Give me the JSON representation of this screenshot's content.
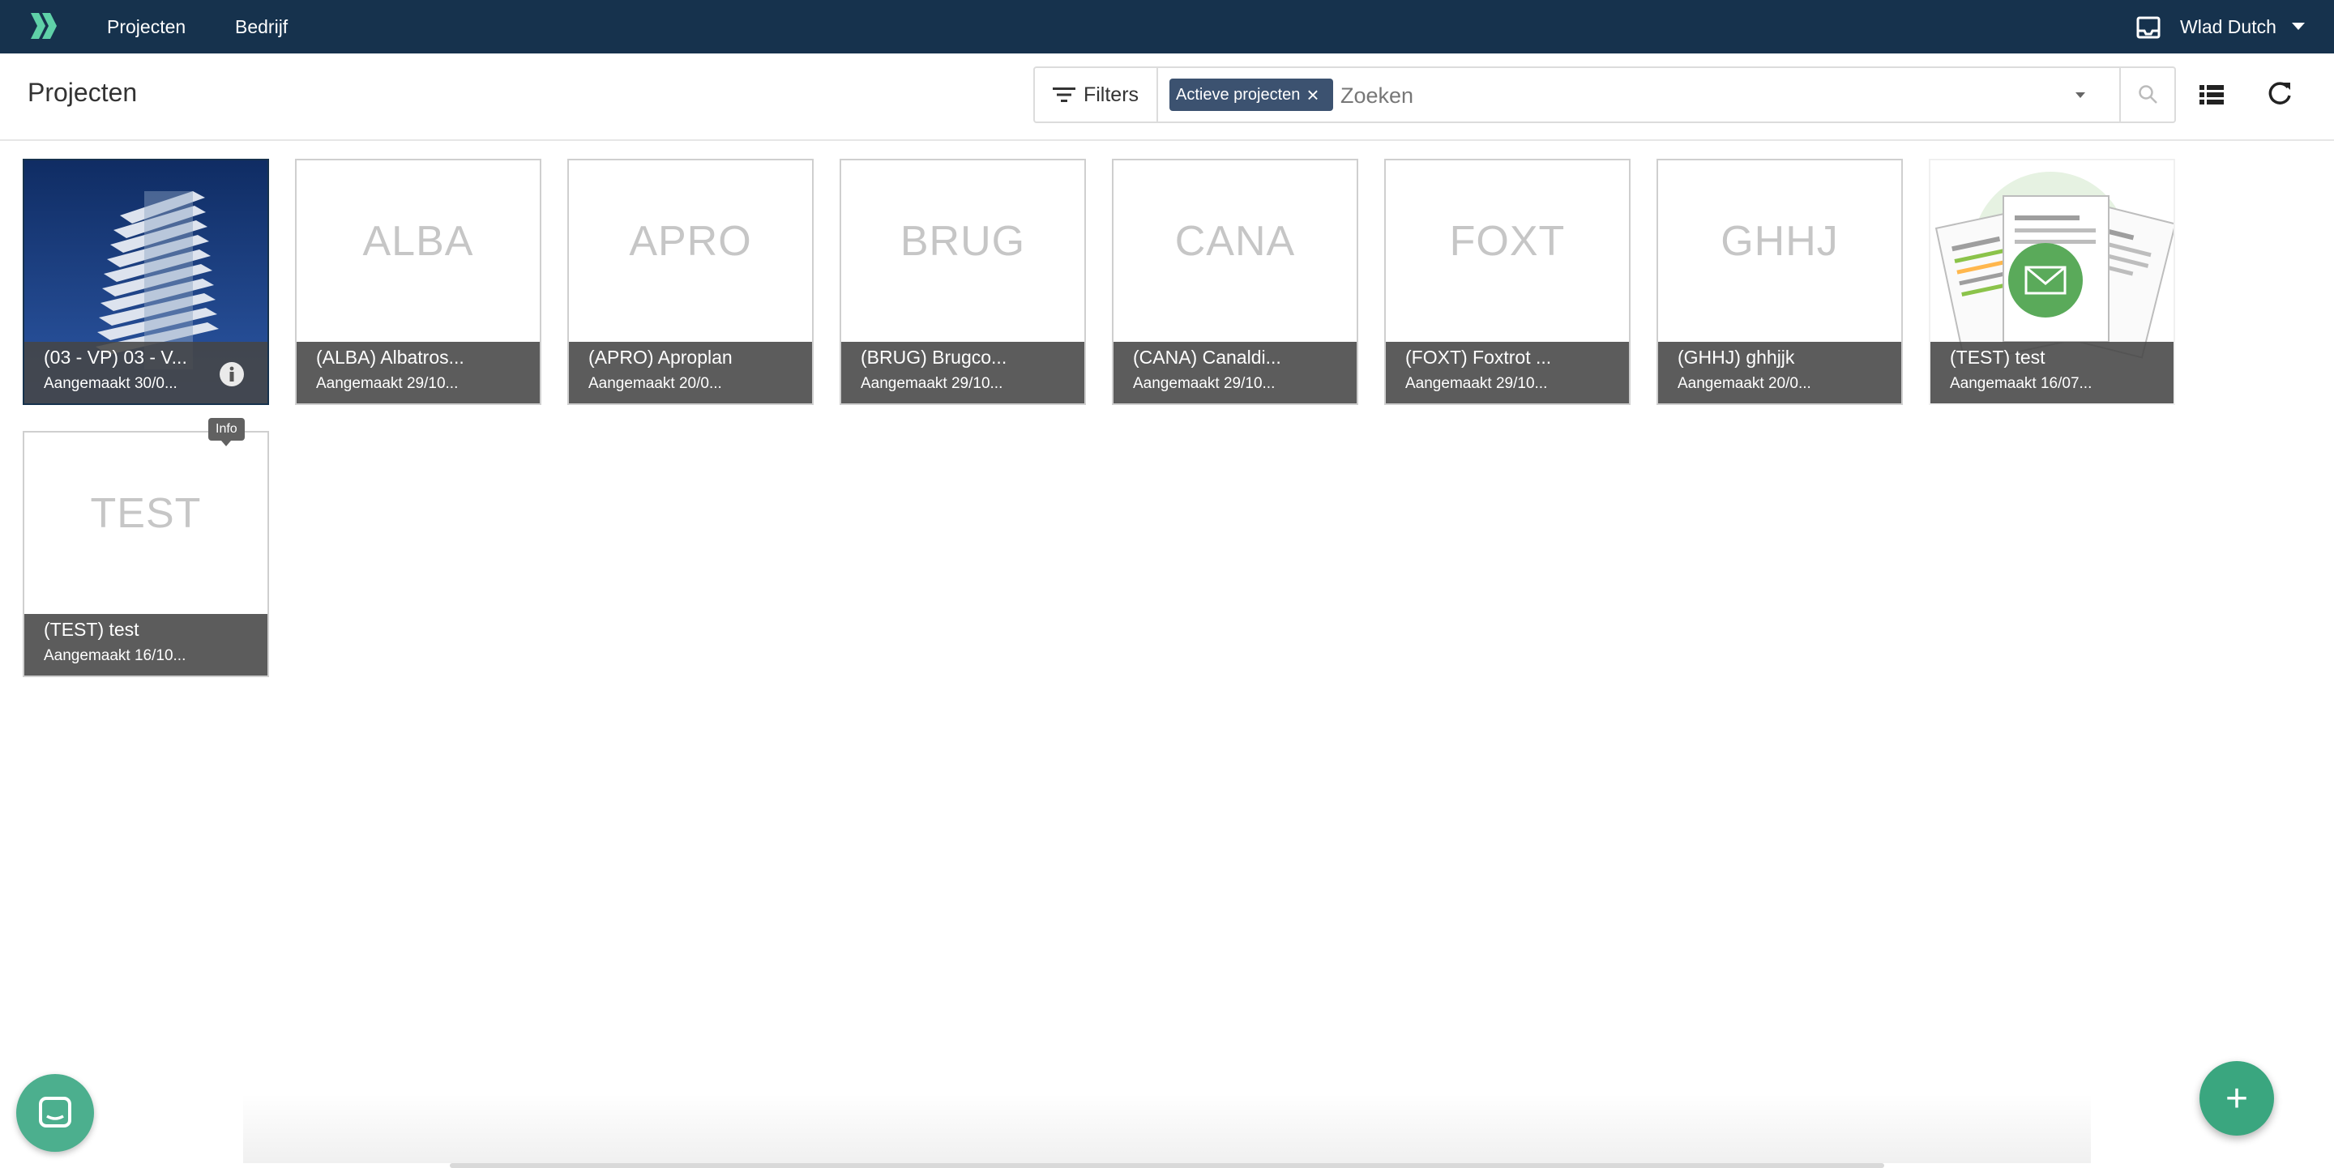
{
  "nav": {
    "items": [
      {
        "label": "Projecten"
      },
      {
        "label": "Bedrijf"
      }
    ],
    "user_name": "Wlad Dutch",
    "logo_icon": "logo-double-chevron-icon",
    "inbox_icon": "inbox-icon"
  },
  "toolbar": {
    "title": "Projecten",
    "filters_label": "Filters",
    "active_chip": "Actieve projecten",
    "search_placeholder": "Zoeken",
    "search_value": ""
  },
  "cards": [
    {
      "code": "",
      "name": "(03 - VP) 03 - V...",
      "date": "Aangemaakt 30/0...",
      "image": "building-photo"
    },
    {
      "code": "ALBA",
      "name": "(ALBA) Albatros...",
      "date": "Aangemaakt 29/10..."
    },
    {
      "code": "APRO",
      "name": "(APRO) Aproplan",
      "date": "Aangemaakt 20/0..."
    },
    {
      "code": "BRUG",
      "name": "(BRUG) Brugco...",
      "date": "Aangemaakt 29/10..."
    },
    {
      "code": "CANA",
      "name": "(CANA) Canaldi...",
      "date": "Aangemaakt 29/10..."
    },
    {
      "code": "FOXT",
      "name": "(FOXT) Foxtrot ...",
      "date": "Aangemaakt 29/10..."
    },
    {
      "code": "GHHJ",
      "name": "(GHHJ) ghhjjk",
      "date": "Aangemaakt 20/0..."
    },
    {
      "code": "",
      "name": "(TEST) test",
      "date": "Aangemaakt 16/07...",
      "image": "documents-mail-illustration"
    },
    {
      "code": "TEST",
      "name": "(TEST) test",
      "date": "Aangemaakt 16/10..."
    }
  ],
  "tooltip": "Info",
  "colors": {
    "nav_bg": "#16324d",
    "chip_bg": "#3c5270",
    "accent_green": "#3aa67f",
    "card_footer": "#464646"
  }
}
